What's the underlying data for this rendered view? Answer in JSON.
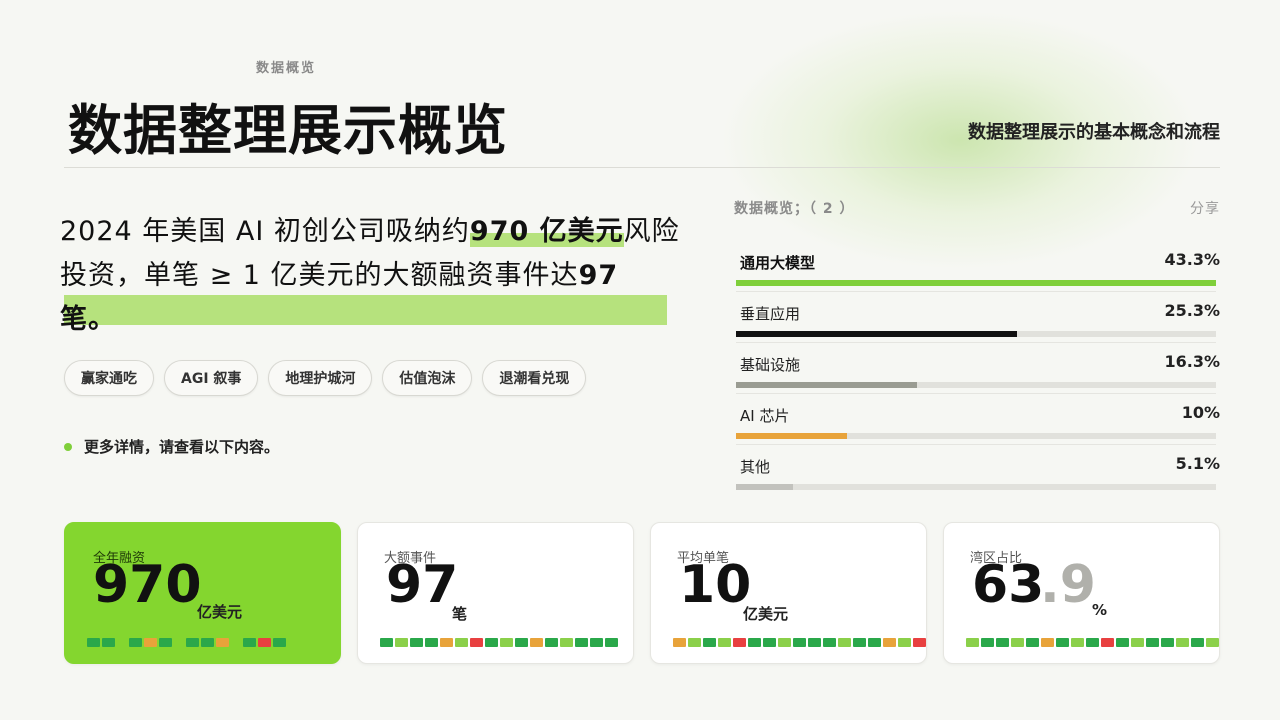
{
  "header": {
    "eyebrow": "数据概览",
    "title": "数据整理展示概览",
    "subtitle": "数据整理展示的基本概念和流程"
  },
  "lead": {
    "part1": "2024 年美国 AI 初创公司吸纳约",
    "highlight1": "970 亿美元",
    "part2": "风险投资，单笔 ≥ 1 亿美元的大额融资事件达",
    "highlight2": "97 笔",
    "part3": "。"
  },
  "tags": [
    "赢家通吃",
    "AGI 叙事",
    "地理护城河",
    "估值泡沫",
    "退潮看兑现"
  ],
  "note": "更多详情，请查看以下内容。",
  "panel": {
    "heading": "数据概览；（ 2 ）",
    "share": "分享",
    "rows": [
      {
        "label": "通用大模型",
        "value": "43.3%",
        "fraction": 1.0,
        "color": "#7fcf3a",
        "active": true
      },
      {
        "label": "垂直应用",
        "value": "25.3%",
        "fraction": 0.585,
        "color": "#111111",
        "active": false
      },
      {
        "label": "基础设施",
        "value": "16.3%",
        "fraction": 0.377,
        "color": "#9a9c92",
        "active": false
      },
      {
        "label": "AI 芯片",
        "value": "10%",
        "fraction": 0.231,
        "color": "#e8a33a",
        "active": false
      },
      {
        "label": "其他",
        "value": "5.1%",
        "fraction": 0.118,
        "color": "#c2c2bd",
        "active": false
      }
    ]
  },
  "cards": [
    {
      "label": "全年融资",
      "num": "970",
      "unit": "亿美元",
      "green": true,
      "squares": [
        "#2aa84a",
        "#2aa84a",
        "gap",
        "#2aa84a",
        "#e8a33a",
        "#2aa84a",
        "gap",
        "#2aa84a",
        "#2aa84a",
        "#e8a33a",
        "gap",
        "#2aa84a",
        "#e84040",
        "#2aa84a"
      ]
    },
    {
      "label": "大额事件",
      "num": "97",
      "unit": "笔",
      "green": false,
      "squares": [
        "#2aa84a",
        "#8bd04a",
        "#2aa84a",
        "#2aa84a",
        "#e8a33a",
        "#8bd04a",
        "#e84040",
        "#2aa84a",
        "#8bd04a",
        "#2aa84a",
        "#e8a33a",
        "#2aa84a",
        "#8bd04a",
        "#2aa84a",
        "#2aa84a",
        "#2aa84a"
      ]
    },
    {
      "label": "平均单笔",
      "num": "10",
      "unit": "亿美元",
      "green": false,
      "squares": [
        "#e8a33a",
        "#8bd04a",
        "#2aa84a",
        "#8bd04a",
        "#e84040",
        "#2aa84a",
        "#2aa84a",
        "#8bd04a",
        "#2aa84a",
        "#2aa84a",
        "#2aa84a",
        "#8bd04a",
        "#2aa84a",
        "#2aa84a",
        "#e8a33a",
        "#8bd04a",
        "#e84040"
      ]
    },
    {
      "label": "湾区占比",
      "num": "63",
      "num2": ".9",
      "unit": "%",
      "green": false,
      "squares": [
        "#8bd04a",
        "#2aa84a",
        "#2aa84a",
        "#8bd04a",
        "#2aa84a",
        "#e8a33a",
        "#2aa84a",
        "#8bd04a",
        "#2aa84a",
        "#e84040",
        "#2aa84a",
        "#8bd04a",
        "#2aa84a",
        "#2aa84a",
        "#8bd04a",
        "#2aa84a",
        "#8bd04a"
      ]
    }
  ]
}
